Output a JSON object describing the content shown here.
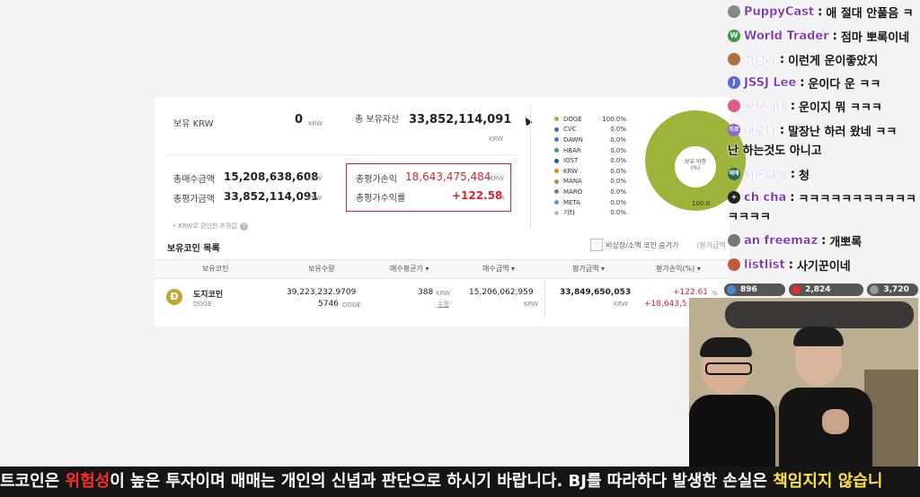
{
  "summary": {
    "krw_label": "보유 KRW",
    "krw_value": "0",
    "krw_unit": "KRW",
    "total_holdings_label": "총 보유자산",
    "total_holdings_value": "33,852,114,091",
    "total_holdings_unit": "KRW",
    "total_buy_label": "총매수금액",
    "total_buy_value": "15,208,638,608",
    "total_buy_unit": "KRW",
    "total_eval_label": "총평가금액",
    "total_eval_value": "33,852,114,091",
    "total_eval_unit": "KRW",
    "pnl_label": "총평가손익",
    "pnl_value": "18,643,475,484",
    "pnl_unit": "KRW",
    "return_label": "총평가수익률",
    "return_value": "+122.58",
    "return_unit": "%",
    "hint": "• KRW로 환산한 추정값"
  },
  "allocation": {
    "legend": [
      {
        "name": "DOGE",
        "pct": "100.0%",
        "color": "#9cb43a"
      },
      {
        "name": "CVC",
        "pct": "0.0%",
        "color": "#3f6ab3"
      },
      {
        "name": "DAWN",
        "pct": "0.0%",
        "color": "#3a7fc7"
      },
      {
        "name": "HBAR",
        "pct": "0.0%",
        "color": "#2f9a9a"
      },
      {
        "name": "IOST",
        "pct": "0.0%",
        "color": "#1f5fa0"
      },
      {
        "name": "KRW",
        "pct": "0.0%",
        "color": "#e0842c"
      },
      {
        "name": "MANA",
        "pct": "0.0%",
        "color": "#9a9a3a"
      },
      {
        "name": "MARO",
        "pct": "0.0%",
        "color": "#7a6cc7"
      },
      {
        "name": "META",
        "pct": "0.0%",
        "color": "#4ea0d0"
      },
      {
        "name": "기타",
        "pct": "0.0%",
        "color": "#bbbbbb"
      }
    ],
    "center_label": "보유 비중",
    "center_unit": "(%)",
    "value_label": "100.0"
  },
  "list": {
    "title": "보유코인 목록",
    "hide_small_label": "비상장/소액 코인 숨기기",
    "sort_label": "(평가금액",
    "columns": [
      "보유코인",
      "보유수량",
      "매수평균가 ▾",
      "매수금액 ▾",
      "평가금액 ▾",
      "평가손익(%) ▾"
    ],
    "rows": [
      {
        "icon": "Ð",
        "name": "도지코인",
        "symbol": "DOGE",
        "qty_line1": "39,223,232.9709",
        "qty_line2": "5746",
        "qty_unit": "DOGE",
        "avg_price": "388",
        "avg_unit": "KRW",
        "avg_action": "수정",
        "buy_amount": "15,206,062,959",
        "buy_unit": "KRW",
        "eval_amount": "33,849,650,053",
        "eval_unit": "KRW",
        "pnl_pct": "+122.61",
        "pnl_pct_unit": "%",
        "pnl_amount": "+18,643,5"
      }
    ]
  },
  "chat": [
    {
      "nick": "PuppyCast",
      "text": "애 절대 안풀음 ㅋ",
      "avatar_color": "#888",
      "avatar_text": ""
    },
    {
      "nick": "World Trader",
      "text": "점마 뽀록이네",
      "avatar_color": "#3a9a4a",
      "avatar_text": "W"
    },
    {
      "nick": "최달리",
      "text": "이런게 운이좋았지",
      "avatar_color": "#b07040",
      "avatar_text": ""
    },
    {
      "nick": "JSSJ Lee",
      "text": "운이다 운 ㅋㅋ",
      "avatar_color": "#5a6acf",
      "avatar_text": "J"
    },
    {
      "nick": "붕붕이네",
      "text": "운이지 뭐 ㅋㅋㅋ",
      "avatar_color": "#e05a8a",
      "avatar_text": ""
    },
    {
      "nick": "미로니",
      "text": "말장난 하러 왔네 ㅋㅋ",
      "avatar_color": "#8a6acf",
      "avatar_text": "미로"
    },
    {
      "nick": "",
      "text": "난 하는것도 아니고",
      "avatar_color": "",
      "avatar_text": ""
    },
    {
      "nick": "뇌동매매",
      "text": "청",
      "avatar_color": "#2a6a5a",
      "avatar_text": "매매"
    },
    {
      "nick": "ch cha",
      "text": "ㅋㅋㅋㅋㅋㅋㅋㅋㅋㅋㅋ",
      "avatar_color": "#222",
      "avatar_text": "+"
    },
    {
      "nick": "",
      "text": "ㅋㅋㅋㅋ",
      "avatar_color": "",
      "avatar_text": ""
    },
    {
      "nick": "an freemaz",
      "text": "개뽀록",
      "avatar_color": "#777",
      "avatar_text": ""
    },
    {
      "nick": "listlist",
      "text": "사기꾼이네",
      "avatar_color": "#c05a3a",
      "avatar_text": ""
    }
  ],
  "stats": [
    {
      "value": "896",
      "color": "#4a8ad0",
      "icon": "chat-viewers-icon"
    },
    {
      "value": "2,824",
      "color": "#e03030",
      "icon": "youtube-icon"
    },
    {
      "value": "3,720",
      "color": "#999999",
      "icon": "viewers-icon"
    }
  ],
  "banner": {
    "part1": "트코인은 ",
    "part2": "위험성",
    "part3": "이 높은 투자이며 매매는 개인의 신념과 판단으로 하시기 바랍니다. BJ를 따라하다 발생한 손실은 ",
    "part4": "책임지지 않습니",
    "color_red": "#ff2b2b",
    "color_yellow": "#ffe14a"
  }
}
